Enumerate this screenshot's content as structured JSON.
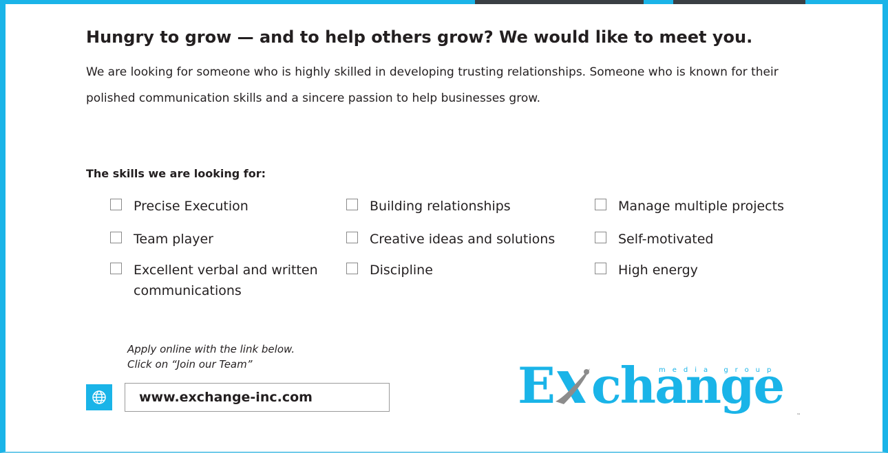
{
  "headline": "Hungry to grow — and to help others grow? We would like to meet you.",
  "intro": "We are looking for someone who is highly skilled in developing trusting relationships.  Someone who is known for their polished communication skills and a sincere passion to help businesses grow.",
  "skills": {
    "title": "The skills we are looking for:",
    "items": [
      {
        "label": "Precise Execution",
        "checked": false
      },
      {
        "label": "Building relationships",
        "checked": false
      },
      {
        "label": "Manage multiple projects",
        "checked": false
      },
      {
        "label": "Team player",
        "checked": false
      },
      {
        "label": "Creative ideas and solutions",
        "checked": false
      },
      {
        "label": "Self-motivated",
        "checked": false
      },
      {
        "label": "Excellent verbal and written communications",
        "checked": false
      },
      {
        "label": "Discipline",
        "checked": false
      },
      {
        "label": "High energy",
        "checked": false
      }
    ]
  },
  "apply": {
    "line1": "Apply online with the link below.",
    "line2": "Click on “Join our Team”"
  },
  "website": {
    "icon": "globe-icon",
    "url": "www.exchange-inc.com"
  },
  "logo": {
    "text_before": "E",
    "text_after": "change",
    "tagline": "media group",
    "tm": "™"
  },
  "colors": {
    "accent": "#1ab4e8",
    "text": "#231f20",
    "box_border": "#8a8a8a"
  }
}
